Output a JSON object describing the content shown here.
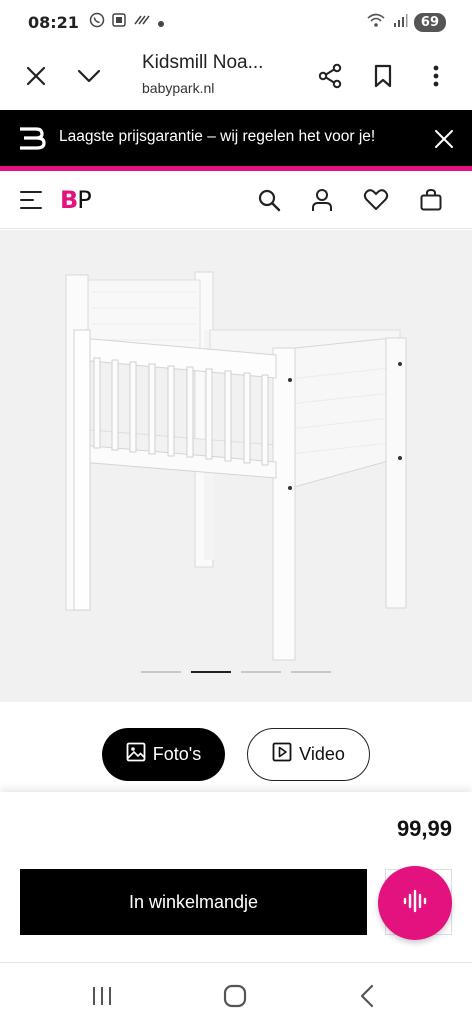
{
  "status_bar": {
    "time": "08:21",
    "battery": "69",
    "icons": [
      "whatsapp-icon",
      "screenshot-icon",
      "wifi-calling-icon",
      "dot-icon",
      "wifi-icon",
      "signal-icon"
    ]
  },
  "browser": {
    "title": "Kidsmill Noa...",
    "domain": "babypark.nl",
    "icons": [
      "close-icon",
      "chevron-down-icon",
      "share-icon",
      "bookmark-icon",
      "more-icon"
    ]
  },
  "promo": {
    "text": "Laagste prijsgarantie – wij regelen het voor je!",
    "accent_color": "#e3127e"
  },
  "site_header": {
    "logo_b": "B",
    "logo_p": "P",
    "icons": [
      "menu-icon",
      "search-icon",
      "account-icon",
      "heart-icon",
      "bag-icon"
    ]
  },
  "gallery": {
    "slides": 4,
    "active_slide": 2
  },
  "media_buttons": {
    "photos_label": "Foto's",
    "video_label": "Video"
  },
  "purchase": {
    "price": "99,99",
    "add_to_cart_label": "In winkelmandje",
    "brand_color": "#e3127e"
  },
  "nav_bar": {
    "icons": [
      "recents-icon",
      "home-icon",
      "back-icon"
    ]
  }
}
